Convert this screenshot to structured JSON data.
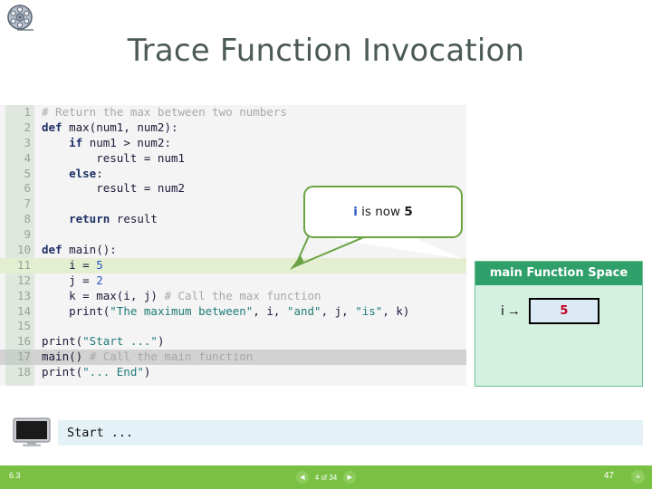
{
  "header": {
    "icon": "film-reel-icon",
    "title": "Trace Function Invocation"
  },
  "code": {
    "lines": [
      {
        "n": "1",
        "html": "<span class=\"tok-com\"># Return the max between two numbers</span>",
        "highlight": "none"
      },
      {
        "n": "2",
        "html": "<span class=\"tok-kw\">def</span> max(num1, num2):",
        "highlight": "none"
      },
      {
        "n": "3",
        "html": "    <span class=\"tok-kw\">if</span> num1 &gt; num2:",
        "highlight": "none"
      },
      {
        "n": "4",
        "html": "        result = num1",
        "highlight": "none"
      },
      {
        "n": "5",
        "html": "    <span class=\"tok-kw\">else</span>:",
        "highlight": "none"
      },
      {
        "n": "6",
        "html": "        result = num2",
        "highlight": "none"
      },
      {
        "n": "7",
        "html": "",
        "highlight": "none"
      },
      {
        "n": "8",
        "html": "    <span class=\"tok-kw\">return</span> result",
        "highlight": "none"
      },
      {
        "n": "9",
        "html": "",
        "highlight": "none"
      },
      {
        "n": "10",
        "html": "<span class=\"tok-kw\">def</span> main():",
        "highlight": "none"
      },
      {
        "n": "11",
        "html": "    i = <span class=\"tok-num\">5</span>",
        "highlight": "green"
      },
      {
        "n": "12",
        "html": "    j = <span class=\"tok-num\">2</span>",
        "highlight": "none"
      },
      {
        "n": "13",
        "html": "    k = max(i, j) <span class=\"tok-com\"># Call the max function</span>",
        "highlight": "none"
      },
      {
        "n": "14",
        "html": "    print(<span class=\"tok-str\">\"The maximum between\"</span>, i, <span class=\"tok-str\">\"and\"</span>, j, <span class=\"tok-str\">\"is\"</span>, k)",
        "highlight": "none"
      },
      {
        "n": "15",
        "html": "",
        "highlight": "none"
      },
      {
        "n": "16",
        "html": "print(<span class=\"tok-str\">\"Start ...\"</span>)",
        "highlight": "none"
      },
      {
        "n": "17",
        "html": "main() <span class=\"tok-com\"># Call the main function</span>",
        "highlight": "gray"
      },
      {
        "n": "18",
        "html": "print(<span class=\"tok-str\">\"... End\"</span>)",
        "highlight": "none"
      }
    ],
    "plain_text": [
      "# Return the max between two numbers",
      "def max(num1, num2):",
      "    if num1 > num2:",
      "        result = num1",
      "    else:",
      "        result = num2",
      "",
      "    return result",
      "",
      "def main():",
      "    i = 5",
      "    j = 2",
      "    k = max(i, j) # Call the max function",
      "    print(\"The maximum between\", i, \"and\", j, \"is\", k)",
      "",
      "print(\"Start ...\")",
      "main() # Call the main function",
      "print(\"... End\")"
    ]
  },
  "callout": {
    "variable": "i",
    "middle": " is now ",
    "value": "5",
    "full_text": "i is now 5",
    "border_color": "#6aa344"
  },
  "function_space": {
    "title": "main Function Space",
    "header_color": "#2fa06a",
    "body_color": "#d4f0e0",
    "variables": [
      {
        "name": "i",
        "arrow": "→",
        "value": "5",
        "value_color": "#c00020"
      }
    ]
  },
  "console": {
    "icon": "monitor-icon",
    "output": "Start ..."
  },
  "footer": {
    "left_label": "6.3",
    "prev_icon": "◀",
    "next_icon": "▶",
    "counter": "4 of 34",
    "page_number": "47",
    "menu_icon": "≡",
    "background": "#7ac143"
  }
}
